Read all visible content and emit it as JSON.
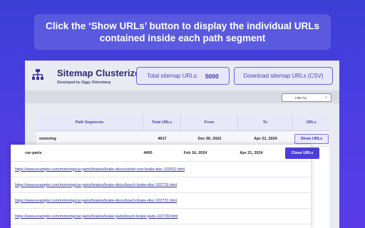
{
  "banner": {
    "text": "Click the ‘Show URLs’ button to display the individual URLs contained inside each path segment"
  },
  "header": {
    "title": "Sitemap Clusterizer",
    "subtitle": "Developed by Ziggy Shtrosberg",
    "total_label": "Total sitemap URLs:",
    "total_value": "5000",
    "download_label": "Download sitemap URLs (CSV)"
  },
  "filter": {
    "selected": "Filter by"
  },
  "table": {
    "headers": [
      "Path Segments",
      "Total URLs",
      "From",
      "To",
      "URLs"
    ],
    "rows": [
      {
        "segment": "motoring",
        "total": "4617",
        "from": "Dec 06, 2022",
        "to": "Apr 21, 2024",
        "action": "Show URLs"
      },
      {
        "segment": "car-parts",
        "total": "4400",
        "from": "Feb 16, 2024",
        "to": "Apr 21, 2024",
        "action": "Close URLs"
      }
    ],
    "urls": [
      "https://www.example.com/motoring/car-parts/brakes/brake-discs/eicher-orm-brake-disc-102611.html",
      "https://www.example.com/motoring/car-parts/brakes/brake-discs/bosch-brake-disc-102715.html",
      "https://www.example.com/motoring/car-parts/brakes/brake-discs/bosch-brake-disc-102731.html",
      "https://www.example.com/motoring/car-parts/brakes/brake-pads/bosch-brake-pads-102739.html"
    ]
  },
  "colors": {
    "accent": "#4b3fd6",
    "background": "#4a3ee0",
    "link": "#2a2f8c"
  },
  "icons": {
    "logo": "sitemap-tree-icon",
    "filter_chevron": "chevron-down-icon"
  }
}
